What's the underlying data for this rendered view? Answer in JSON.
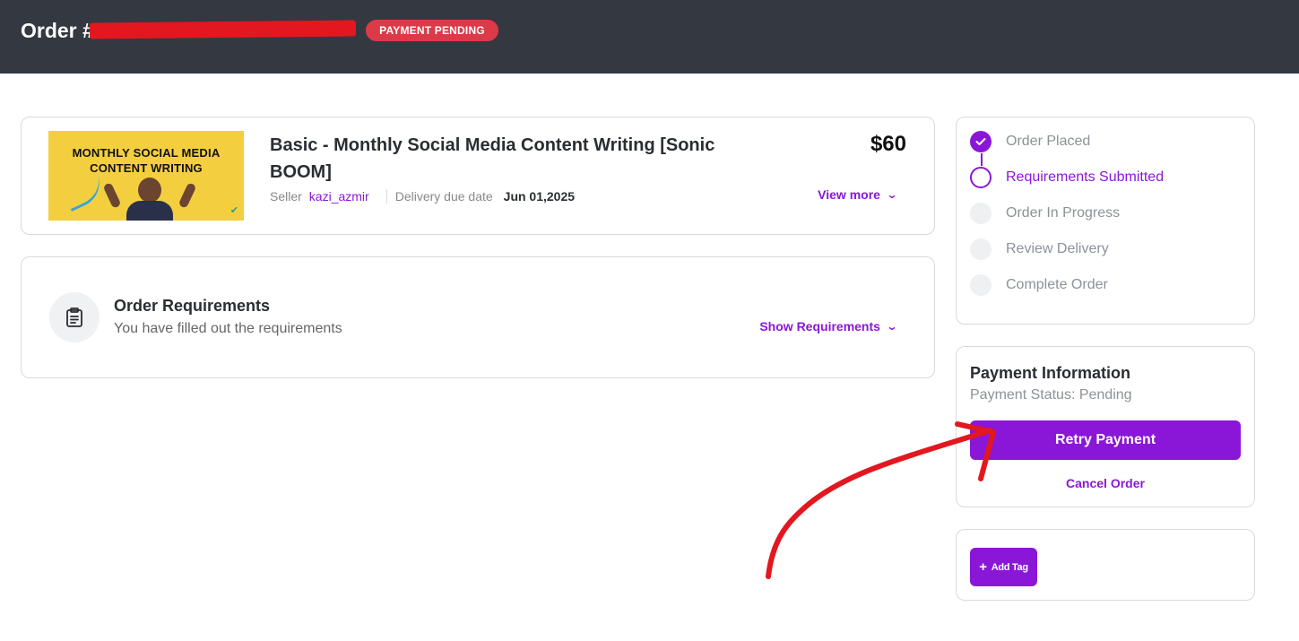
{
  "header": {
    "order_prefix": "Order #",
    "status_badge": "PAYMENT PENDING"
  },
  "product": {
    "thumbnail_text": "MONTHLY  SOCIAL MEDIA CONTENT WRITING",
    "title": "Basic - Monthly Social Media Content Writing [Sonic BOOM]",
    "seller_label": "Seller",
    "seller_name": "kazi_azmir",
    "delivery_label": "Delivery due date",
    "delivery_date": "Jun 01,2025",
    "price": "$60",
    "view_more": "View more"
  },
  "requirements": {
    "title": "Order Requirements",
    "subtitle": "You have filled out the requirements",
    "show_label": "Show Requirements"
  },
  "steps": [
    {
      "label": "Order Placed",
      "state": "done"
    },
    {
      "label": "Requirements Submitted",
      "state": "current"
    },
    {
      "label": "Order In Progress",
      "state": "pending"
    },
    {
      "label": "Review Delivery",
      "state": "pending"
    },
    {
      "label": "Complete Order",
      "state": "pending"
    }
  ],
  "payment": {
    "title": "Payment Information",
    "status": "Payment Status: Pending",
    "retry_label": "Retry Payment",
    "cancel_label": "Cancel Order"
  },
  "tag": {
    "add_label": "Add Tag"
  },
  "colors": {
    "accent": "#8a17d8",
    "header_bg": "#343841",
    "badge_red": "#dc3a48",
    "annotation_red": "#e3171f"
  }
}
